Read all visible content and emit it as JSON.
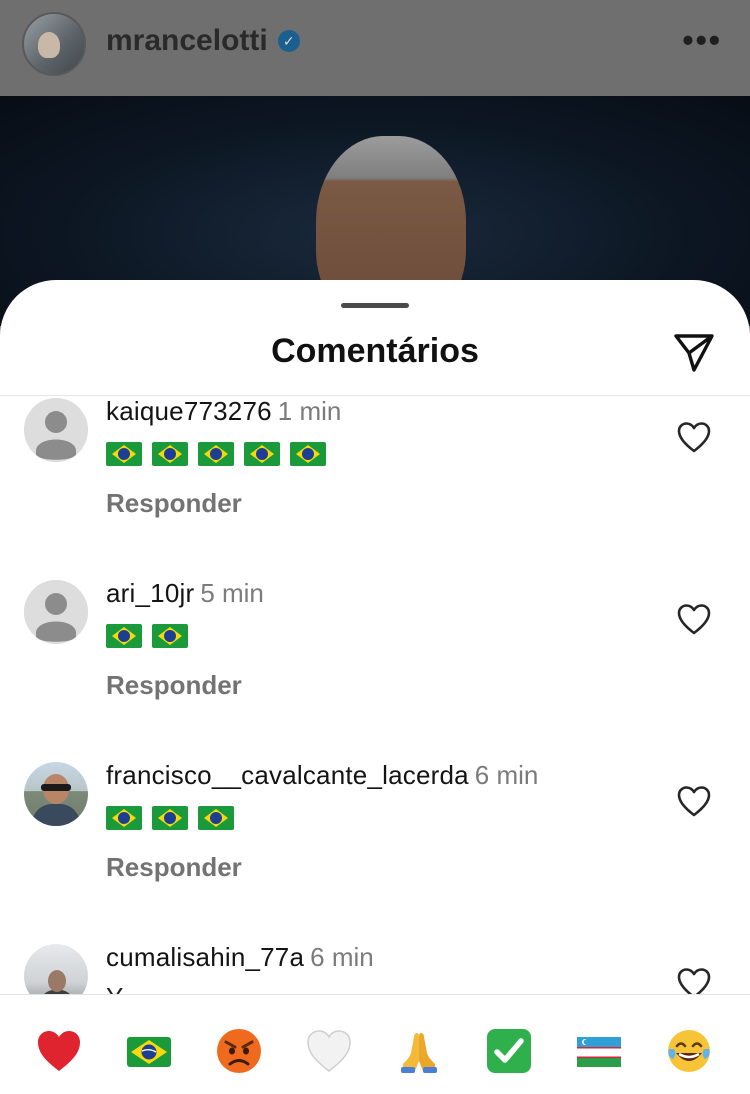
{
  "post_header": {
    "username": "mrancelotti",
    "verified_icon": "verified-check-icon",
    "more_icon": "more-dots-icon"
  },
  "sheet": {
    "title": "Comentários",
    "share_icon": "send-icon"
  },
  "comments": [
    {
      "username": "kaique773276",
      "time": "1 min",
      "flags": 5,
      "reply_label": "Responder",
      "avatar": "default-avatar"
    },
    {
      "username": "ari_10jr",
      "time": "5 min",
      "flags": 2,
      "reply_label": "Responder",
      "avatar": "default-avatar"
    },
    {
      "username": "francisco__cavalcante_lacerda",
      "time": "6 min",
      "flags": 3,
      "reply_label": "Responder",
      "avatar": "profile-photo"
    },
    {
      "username": "cumalisahin_77a",
      "time": "6 min",
      "partial_text": "Y",
      "avatar": "profile-photo"
    }
  ],
  "emoji_bar": [
    "red-heart",
    "brazil-flag",
    "angry-face",
    "white-heart",
    "folded-hands",
    "check-mark-button",
    "uzbekistan-flag",
    "tears-of-joy-face"
  ],
  "colors": {
    "accent_green": "#1a9a3b",
    "heart_red": "#e0242f",
    "check_green": "#2fb04c",
    "time_gray": "#7b7b7b",
    "reply_gray": "#737373"
  }
}
